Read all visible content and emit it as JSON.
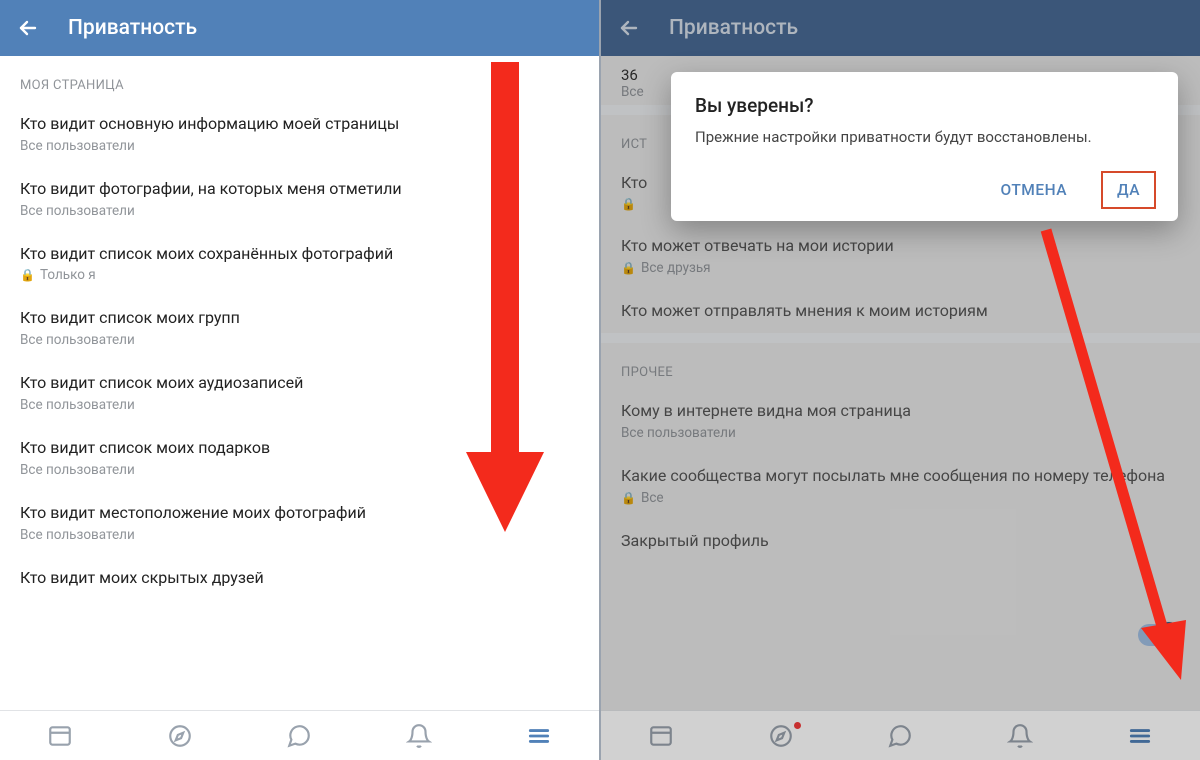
{
  "left": {
    "header_title": "Приватность",
    "section1": "МОЯ СТРАНИЦА",
    "items": [
      {
        "label": "Кто видит основную информацию моей страницы",
        "sub": "Все пользователи",
        "locked": false
      },
      {
        "label": "Кто видит фотографии, на которых меня отметили",
        "sub": "Все пользователи",
        "locked": false
      },
      {
        "label": "Кто видит список моих сохранённых фотографий",
        "sub": "Только я",
        "locked": true
      },
      {
        "label": "Кто видит список моих групп",
        "sub": "Все пользователи",
        "locked": false
      },
      {
        "label": "Кто видит список моих аудиозаписей",
        "sub": "Все пользователи",
        "locked": false
      },
      {
        "label": "Кто видит список моих подарков",
        "sub": "Все пользователи",
        "locked": false
      },
      {
        "label": "Кто видит местоположение моих фотографий",
        "sub": "Все пользователи",
        "locked": false
      },
      {
        "label": "Кто видит моих скрытых друзей",
        "sub": "",
        "locked": false
      }
    ]
  },
  "right": {
    "header_title": "Приватность",
    "top_num": "36",
    "top_sub": "Все",
    "section_hist": "ИСТ",
    "hist_trunc": "Кто",
    "items_hist": [
      {
        "label": "Кто может отвечать на мои истории",
        "sub": "Все друзья",
        "locked": true
      },
      {
        "label": "Кто может отправлять мнения к моим историям",
        "sub": "",
        "locked": false
      }
    ],
    "section_other": "ПРОЧЕЕ",
    "items_other": [
      {
        "label": "Кому в интернете видна моя страница",
        "sub": "Все пользователи",
        "locked": false
      },
      {
        "label": "Какие сообщества могут посылать мне сообщения по номеру телефона",
        "sub": "Все",
        "locked": true
      }
    ],
    "closed_profile_label": "Закрытый профиль",
    "dialog": {
      "title": "Вы уверены?",
      "message": "Прежние настройки приватности будут восстановлены.",
      "cancel": "ОТМЕНА",
      "ok": "ДА"
    }
  },
  "colors": {
    "accent": "#5181b8",
    "arrow": "#f32a1c"
  }
}
